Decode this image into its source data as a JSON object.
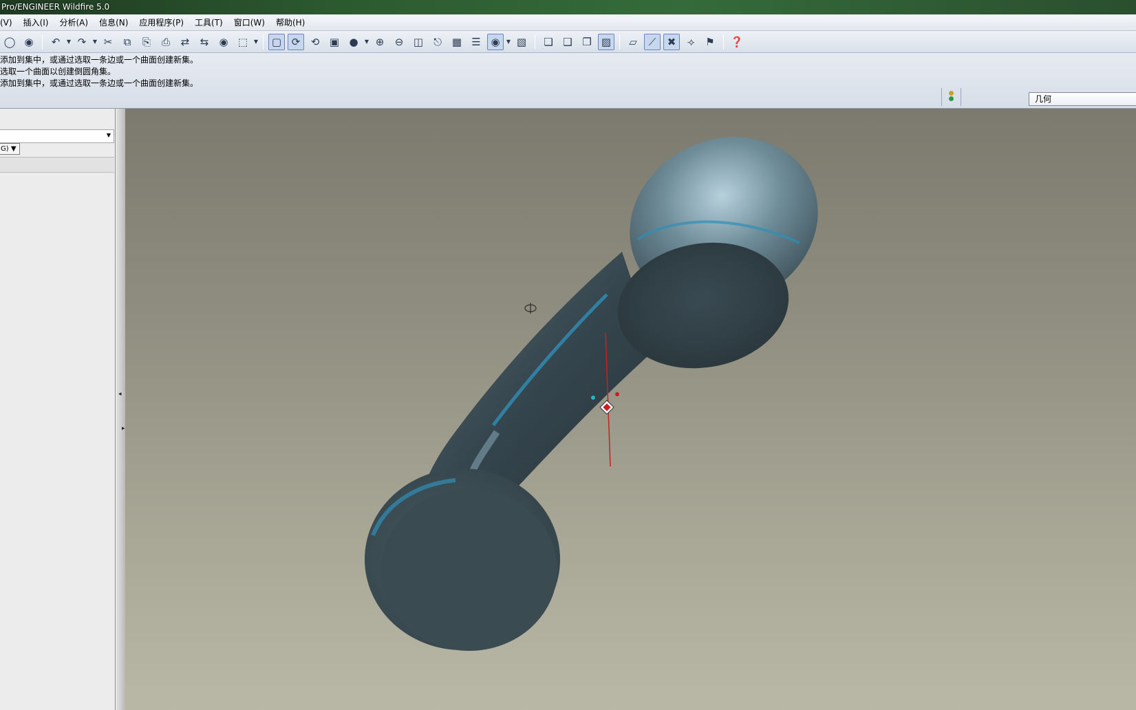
{
  "window": {
    "title": "Pro/ENGINEER Wildfire 5.0"
  },
  "menu": {
    "items": [
      "(V)",
      "插入(I)",
      "分析(A)",
      "信息(N)",
      "应用程序(P)",
      "工具(T)",
      "窗口(W)",
      "帮助(H)"
    ]
  },
  "toolbar": {
    "icons": [
      "regenerate-icon",
      "regenerate-manager-icon",
      "undo-icon",
      "redo-icon",
      "cut-icon",
      "copy-icon",
      "paste-icon",
      "paste-special-icon",
      "mirror-icon",
      "pattern-icon",
      "find-icon",
      "select-box-icon",
      "repaint-icon",
      "spin-center-icon",
      "orient-mode-icon",
      "saved-views-icon",
      "shading-icon",
      "zoom-in-icon",
      "zoom-out-icon",
      "refit-icon",
      "reorient-icon",
      "view-manager-icon",
      "layers-icon",
      "appearance-icon",
      "model-display-icon",
      "wireframe-icon",
      "hidden-line-icon",
      "no-hidden-icon",
      "shaded-icon",
      "datum-planes-icon",
      "datum-axes-icon",
      "datum-points-icon",
      "coordinate-systems-icon",
      "annotations-icon",
      "context-help-icon"
    ]
  },
  "messages": {
    "line1": "添加到集中，或通过选取一条边或一个曲面创建新集。",
    "line2": "选取一个曲面以创建倒圆角集。",
    "line3": "添加到集中，或通过选取一条边或一个曲面创建新集。"
  },
  "status": {
    "filter_value": "几何"
  },
  "left_panel": {
    "combo_value": "G)"
  },
  "colors": {
    "viewport_top": "#7c7a6e",
    "viewport_bottom": "#b9b7a6",
    "model_body": "#3e5058",
    "model_highlight": "#8fb3c1",
    "model_edge_blue": "#2f8fb6",
    "drag_handle": "#cc1f1f"
  }
}
